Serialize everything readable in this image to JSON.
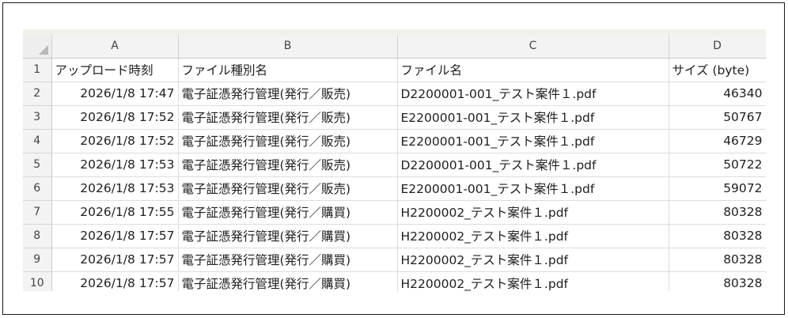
{
  "sheet": {
    "column_headers": [
      "A",
      "B",
      "C",
      "D"
    ],
    "rows": [
      {
        "num": "1",
        "a": "アップロード時刻",
        "b": "ファイル種別名",
        "c": "ファイル名",
        "d": "サイズ (byte)"
      },
      {
        "num": "2",
        "a": "2026/1/8 17:47",
        "b": "電子証憑発行管理(発行／販売)",
        "c": "D2200001-001_テスト案件１.pdf",
        "d": "46340"
      },
      {
        "num": "3",
        "a": "2026/1/8 17:52",
        "b": "電子証憑発行管理(発行／販売)",
        "c": "E2200001-001_テスト案件１.pdf",
        "d": "50767"
      },
      {
        "num": "4",
        "a": "2026/1/8 17:52",
        "b": "電子証憑発行管理(発行／販売)",
        "c": "E2200001-001_テスト案件１.pdf",
        "d": "46729"
      },
      {
        "num": "5",
        "a": "2026/1/8 17:53",
        "b": "電子証憑発行管理(発行／販売)",
        "c": "D2200001-001_テスト案件１.pdf",
        "d": "50722"
      },
      {
        "num": "6",
        "a": "2026/1/8 17:53",
        "b": "電子証憑発行管理(発行／販売)",
        "c": "E2200001-001_テスト案件１.pdf",
        "d": "59072"
      },
      {
        "num": "7",
        "a": "2026/1/8 17:55",
        "b": "電子証憑発行管理(発行／購買)",
        "c": "H2200002_テスト案件１.pdf",
        "d": "80328"
      },
      {
        "num": "8",
        "a": "2026/1/8 17:57",
        "b": "電子証憑発行管理(発行／購買)",
        "c": "H2200002_テスト案件１.pdf",
        "d": "80328"
      },
      {
        "num": "9",
        "a": "2026/1/8 17:57",
        "b": "電子証憑発行管理(発行／購買)",
        "c": "H2200002_テスト案件１.pdf",
        "d": "80328"
      },
      {
        "num": "10",
        "a": "2026/1/8 17:57",
        "b": "電子証憑発行管理(発行／購買)",
        "c": "H2200002_テスト案件１.pdf",
        "d": "80328"
      }
    ]
  }
}
